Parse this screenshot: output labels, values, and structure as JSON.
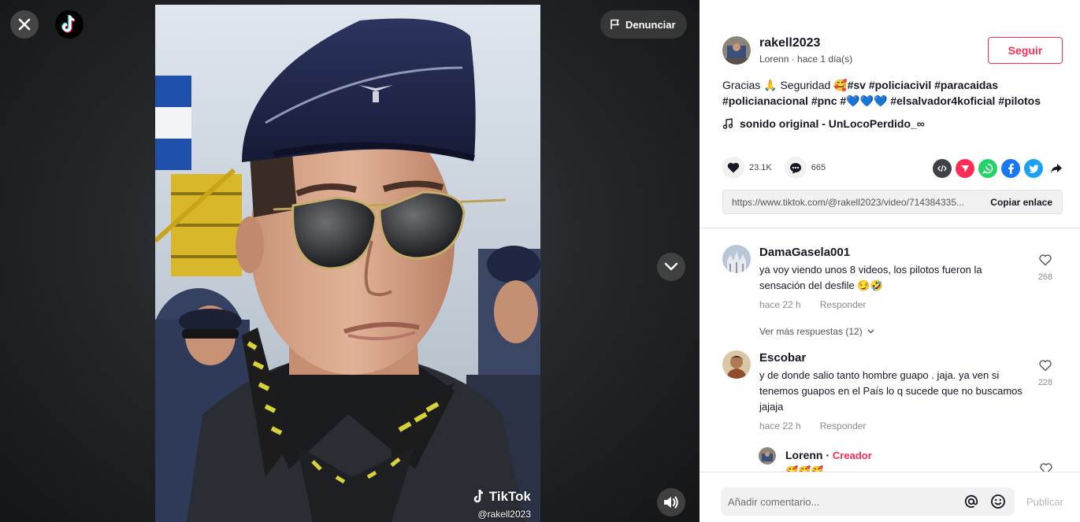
{
  "player": {
    "report_label": "Denunciar",
    "watermark_brand": "TikTok",
    "watermark_user": "@rakell2023"
  },
  "post": {
    "author_username": "rakell2023",
    "author_subtitle": "Lorenn · hace 1 día(s)",
    "follow_label": "Seguir",
    "caption": {
      "text_1": "Gracias 🙏 Seguridad 🥰",
      "tags_1": "#sv #policiacivil #paracaidas",
      "tags_2": "#policianacional #pnc #",
      "hearts": "💙💙💙",
      "tags_3": " #elsalvador4koficial #pilotos"
    },
    "music": "sonido original - UnLocoPerdido_∞",
    "likes": "23.1K",
    "comments_count": "665",
    "link": "https://www.tiktok.com/@rakell2023/video/714384335...",
    "copy_label": "Copiar enlace"
  },
  "comments": [
    {
      "user": "DamaGasela001",
      "text": "ya voy viendo unos 8 videos, los pilotos fueron la sensación del desfile 😏🤣",
      "time": "hace 22 h",
      "reply_label": "Responder",
      "likes": "268",
      "more_replies": "Ver más respuestas (12)"
    },
    {
      "user": "Escobar",
      "text": "y de donde salio tanto hombre guapo . jaja. ya ven si tenemos guapos en el País lo q sucede que no buscamos jajaja",
      "time": "hace 22 h",
      "reply_label": "Responder",
      "likes": "228"
    }
  ],
  "reply": {
    "user": "Lorenn",
    "separator": " · ",
    "badge": "Creador",
    "text": "🥰🥰🥰"
  },
  "composer": {
    "placeholder": "Añadir comentario...",
    "post_label": "Publicar"
  },
  "colors": {
    "accent": "#fe2c55",
    "text": "#161823",
    "muted": "#8a8b91"
  }
}
